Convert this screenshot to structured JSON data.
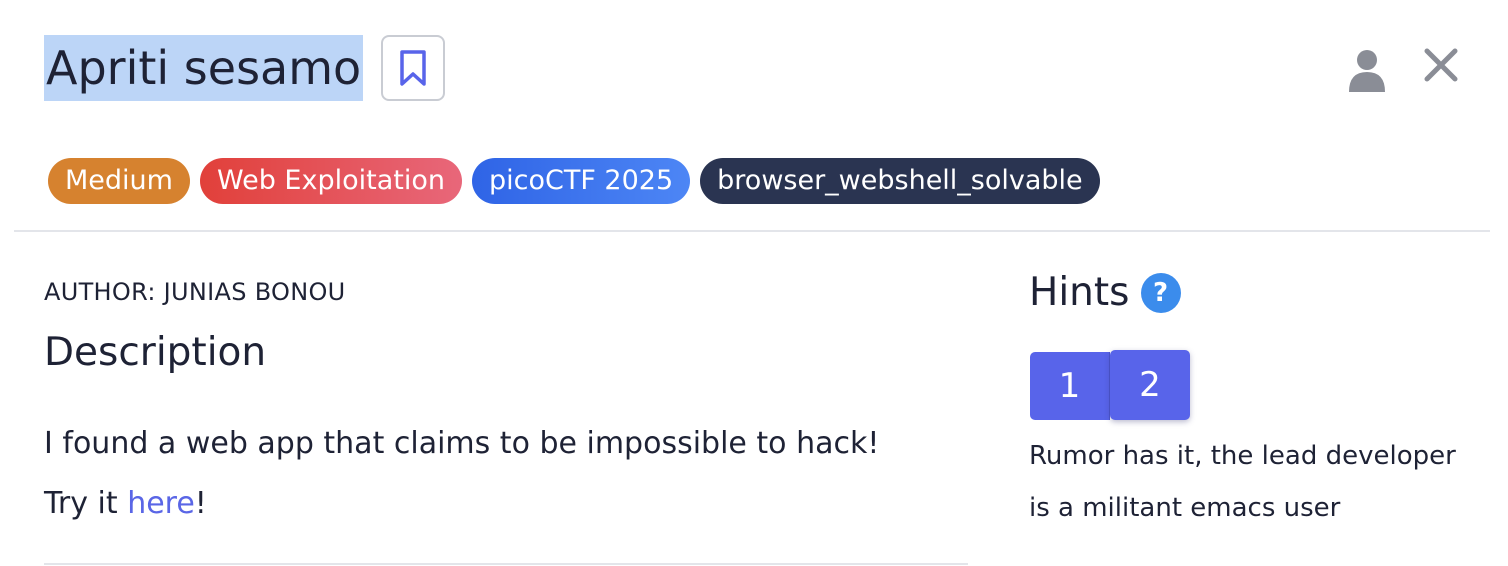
{
  "challenge": {
    "title": "Apriti sesamo"
  },
  "tags": [
    {
      "label": "Medium",
      "color": "#d6822f"
    },
    {
      "label": "Web Exploitation",
      "color": "#e1403a"
    },
    {
      "label": "picoCTF 2025",
      "color": "#2f64e6"
    },
    {
      "label": "browser_webshell_solvable",
      "color": "#2a3451"
    }
  ],
  "author": "AUTHOR: JUNIAS BONOU",
  "description": {
    "heading": "Description",
    "line1": "I found a web app that claims to be impossible to hack!",
    "line2_prefix": "Try it ",
    "link_text": "here",
    "line2_suffix": "!"
  },
  "hints": {
    "heading": "Hints",
    "help_symbol": "?",
    "tabs": [
      "1",
      "2"
    ],
    "active_tab": "2",
    "active_text": "Rumor has it, the lead developer is a militant emacs user"
  },
  "icons": {
    "bookmark": "bookmark-icon",
    "user": "user-icon",
    "close": "close-icon",
    "help": "help-icon"
  },
  "colors": {
    "accent": "#5864ea",
    "link": "#5a66e6",
    "title_highlight": "#bcd5f7",
    "help": "#3b8cec"
  }
}
